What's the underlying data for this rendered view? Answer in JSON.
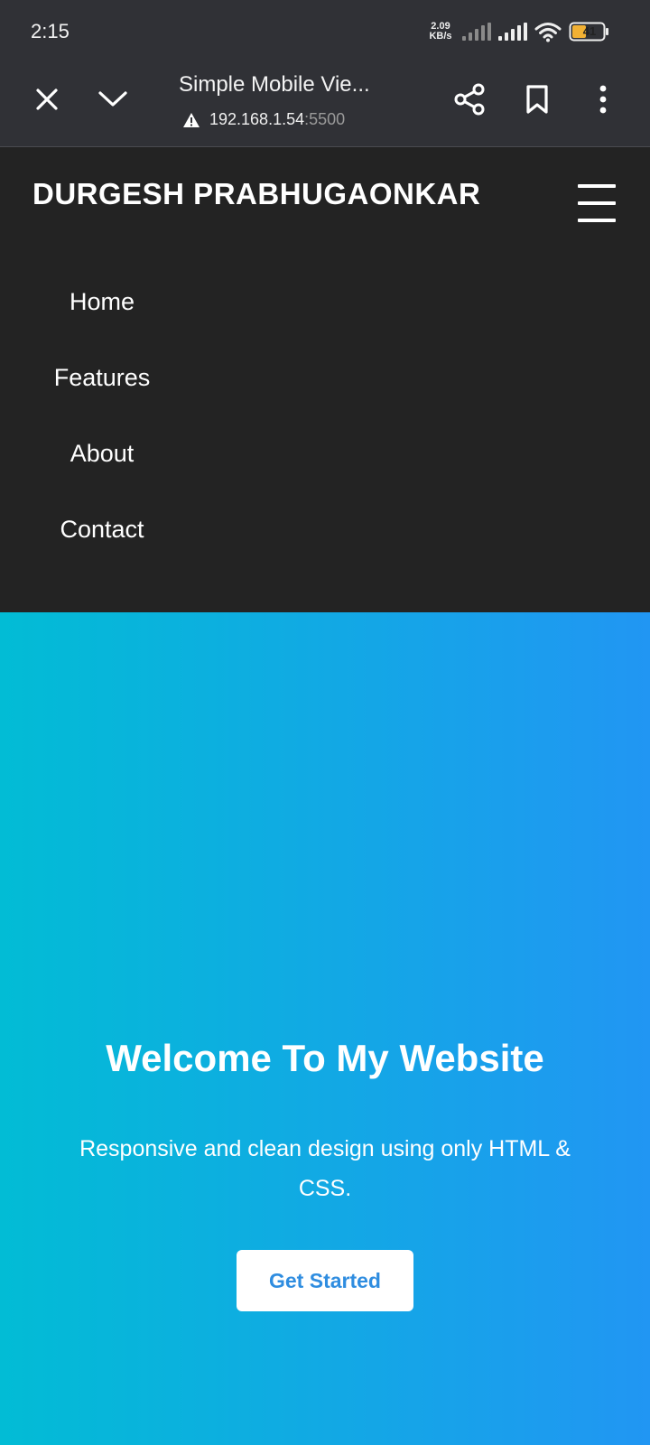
{
  "status_bar": {
    "time": "2:15",
    "net_speed_value": "2.09",
    "net_speed_unit": "KB/s",
    "battery": "41",
    "icons": [
      "signal-icon",
      "signal-icon",
      "wifi-icon",
      "battery-icon"
    ]
  },
  "browser": {
    "title": "Simple Mobile Vie...",
    "url_host": "192.168.1.54",
    "url_port": ":5500",
    "icons": [
      "close-icon",
      "chevron-down-icon",
      "warning-icon",
      "share-icon",
      "bookmark-icon",
      "more-vert-icon"
    ]
  },
  "site": {
    "brand": "DURGESH PRABHUGAONKAR",
    "menu_icon": "hamburger-icon",
    "menu": [
      "Home",
      "Features",
      "About",
      "Contact"
    ],
    "hero": {
      "title": "Welcome To My Website",
      "subtitle": "Responsive and clean design using only HTML & CSS.",
      "button": "Get Started"
    },
    "colors": {
      "nav_bg": "#232323",
      "hero_gradient_start": "#02bcd5",
      "hero_gradient_end": "#2196f3",
      "button_text": "#2f8de0"
    }
  }
}
